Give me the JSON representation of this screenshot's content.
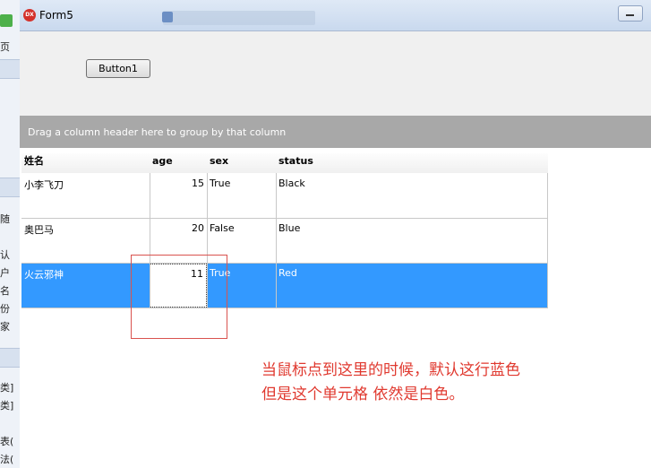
{
  "background_app": {
    "visible_text": [
      "页",
      "随",
      "认",
      "户",
      "名",
      "份",
      "家",
      "类]",
      "类]",
      "表(",
      "法("
    ]
  },
  "window": {
    "title": "Form5",
    "icon_label": "DX"
  },
  "form": {
    "button1_label": "Button1"
  },
  "grid": {
    "group_panel_text": "Drag a column header here to group by that column",
    "columns": [
      "姓名",
      "age",
      "sex",
      "status"
    ],
    "rows": [
      {
        "name": "小李飞刀",
        "age": "15",
        "sex": "True",
        "status": "Black",
        "selected": false
      },
      {
        "name": "奥巴马",
        "age": "20",
        "sex": "False",
        "status": "Blue",
        "selected": false
      },
      {
        "name": "火云邪神",
        "age": "11",
        "sex": "True",
        "status": "Red",
        "selected": true
      }
    ]
  },
  "annotation": {
    "line1": "当鼠标点到这里的时候，默认这行蓝色",
    "line2": "但是这个单元格 依然是白色。"
  },
  "colors": {
    "selection": "#3399ff",
    "group_panel": "#a8a8a8",
    "annotation": "#e0392f"
  }
}
